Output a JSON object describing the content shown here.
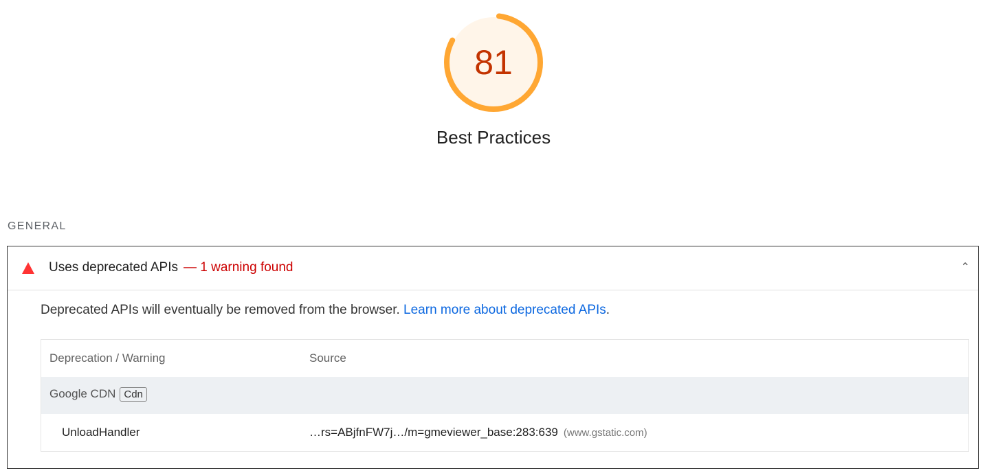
{
  "gauge": {
    "score": "81",
    "fraction": 0.81,
    "title": "Best Practices",
    "color": "#ffa733",
    "fill": "#fff5e9",
    "text_color": "#c33300"
  },
  "group_title": "GENERAL",
  "audit": {
    "title": "Uses deprecated APIs",
    "warning": "— 1 warning found",
    "description": "Deprecated APIs will eventually be removed from the browser.",
    "link": "Learn more about deprecated APIs",
    "link_suffix": ".",
    "table": {
      "headers": [
        "Deprecation / Warning",
        "Source"
      ],
      "group": {
        "name": "Google CDN",
        "badge": "Cdn"
      },
      "rows": [
        {
          "warning": "UnloadHandler",
          "source": "…rs=ABjfnFW7j…/m=gmeviewer_base:283:639",
          "host": "(www.gstatic.com)"
        }
      ]
    }
  }
}
